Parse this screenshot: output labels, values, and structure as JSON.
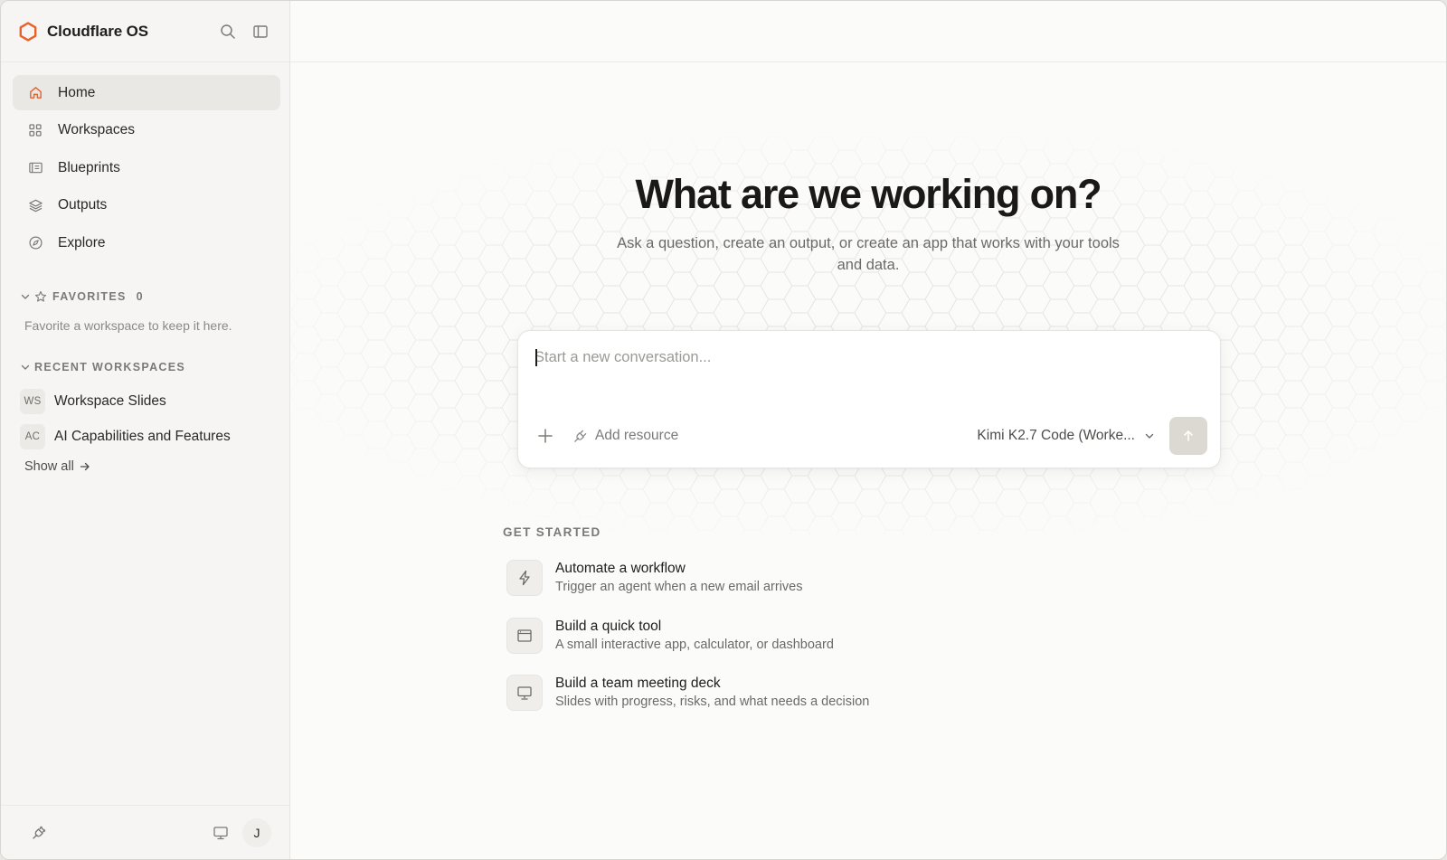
{
  "app": {
    "title": "Cloudflare OS",
    "accent": "#e8622a"
  },
  "header": {
    "search_icon": "search-icon",
    "panel_icon": "sidebar-toggle-icon"
  },
  "nav": {
    "items": [
      {
        "label": "Home",
        "icon": "home-icon",
        "active": true
      },
      {
        "label": "Workspaces",
        "icon": "grid-icon",
        "active": false
      },
      {
        "label": "Blueprints",
        "icon": "blueprint-icon",
        "active": false
      },
      {
        "label": "Outputs",
        "icon": "layers-icon",
        "active": false
      },
      {
        "label": "Explore",
        "icon": "compass-icon",
        "active": false
      }
    ]
  },
  "favorites": {
    "title": "FAVORITES",
    "count": "0",
    "empty_text": "Favorite a workspace to keep it here."
  },
  "recent": {
    "title": "RECENT WORKSPACES",
    "items": [
      {
        "badge": "WS",
        "label": "Workspace Slides"
      },
      {
        "badge": "AC",
        "label": "AI Capabilities and Features"
      }
    ],
    "show_all": "Show all"
  },
  "footer": {
    "user_initial": "J"
  },
  "hero": {
    "title": "What are we working on?",
    "subtitle": "Ask a question, create an output, or create an app that works with your tools and data."
  },
  "composer": {
    "placeholder": "Start a new conversation...",
    "value": "",
    "add_resource": "Add resource",
    "model": "Kimi K2.7 Code (Worke..."
  },
  "get_started": {
    "title": "GET STARTED",
    "items": [
      {
        "title": "Automate a workflow",
        "desc": "Trigger an agent when a new email arrives",
        "icon": "bolt-icon"
      },
      {
        "title": "Build a quick tool",
        "desc": "A small interactive app, calculator, or dashboard",
        "icon": "app-window-icon"
      },
      {
        "title": "Build a team meeting deck",
        "desc": "Slides with progress, risks, and what needs a decision",
        "icon": "presentation-icon"
      }
    ]
  }
}
